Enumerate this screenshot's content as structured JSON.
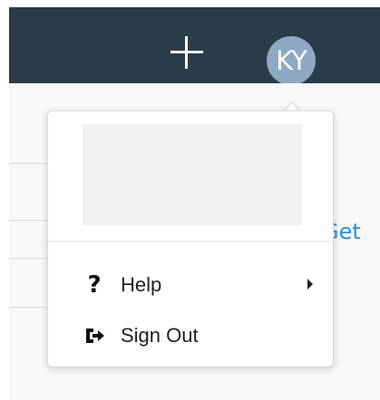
{
  "topbar": {
    "plus_icon": "plus-icon",
    "avatar_initials": "KY",
    "colors": {
      "bar": "#2a3c49",
      "avatar": "#8fa9c2"
    }
  },
  "content": {
    "partial_text": "Get",
    "link_color": "#2f8fd8"
  },
  "menu": {
    "items": [
      {
        "label": "Help",
        "icon": "question-icon",
        "has_submenu": true
      },
      {
        "label": "Sign Out",
        "icon": "sign-out-icon",
        "has_submenu": false
      }
    ]
  }
}
